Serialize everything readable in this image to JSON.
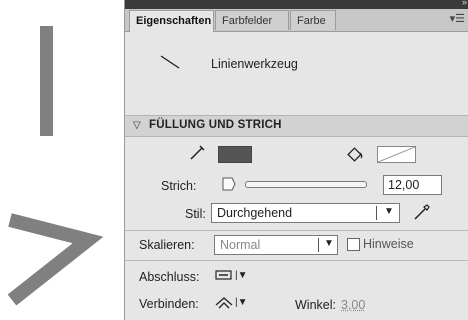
{
  "panel": {
    "tabs": [
      {
        "label": "Eigenschaften",
        "active": true
      },
      {
        "label": "Farbfelder",
        "active": false
      },
      {
        "label": "Farbe",
        "active": false
      }
    ],
    "tool_name": "Linienwerkzeug",
    "section_title": "FÜLLUNG UND STRICH",
    "stroke_color": "#555555",
    "fill_color": "#ffffff",
    "strich_label": "Strich:",
    "strich_value": "12,00",
    "stil_label": "Stil:",
    "stil_value": "Durchgehend",
    "skalieren_label": "Skalieren:",
    "skalieren_value": "Normal",
    "hinweise_label": "Hinweise",
    "abschluss_label": "Abschluss:",
    "verbinden_label": "Verbinden:",
    "winkel_label": "Winkel:",
    "winkel_value": "3,00"
  },
  "canvas": {
    "stroke_color": "#808080"
  }
}
